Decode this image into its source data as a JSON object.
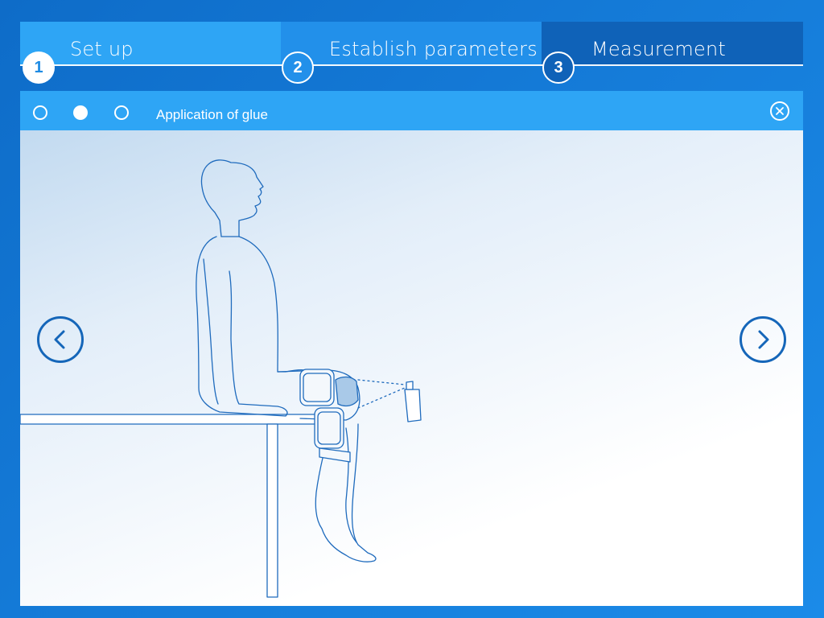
{
  "steps": [
    {
      "number": "1",
      "label": "Set up"
    },
    {
      "number": "2",
      "label": "Establish parameters"
    },
    {
      "number": "3",
      "label": "Measurement"
    }
  ],
  "panel": {
    "title": "Application of glue",
    "pager": {
      "total": 3,
      "active": 2
    }
  },
  "icons": {
    "close": "close-icon",
    "prev": "chevron-left-icon",
    "next": "chevron-right-icon"
  },
  "colors": {
    "accent": "#2ea5f5",
    "dark_step": "#0f62b8",
    "outline": "#1566b9"
  }
}
